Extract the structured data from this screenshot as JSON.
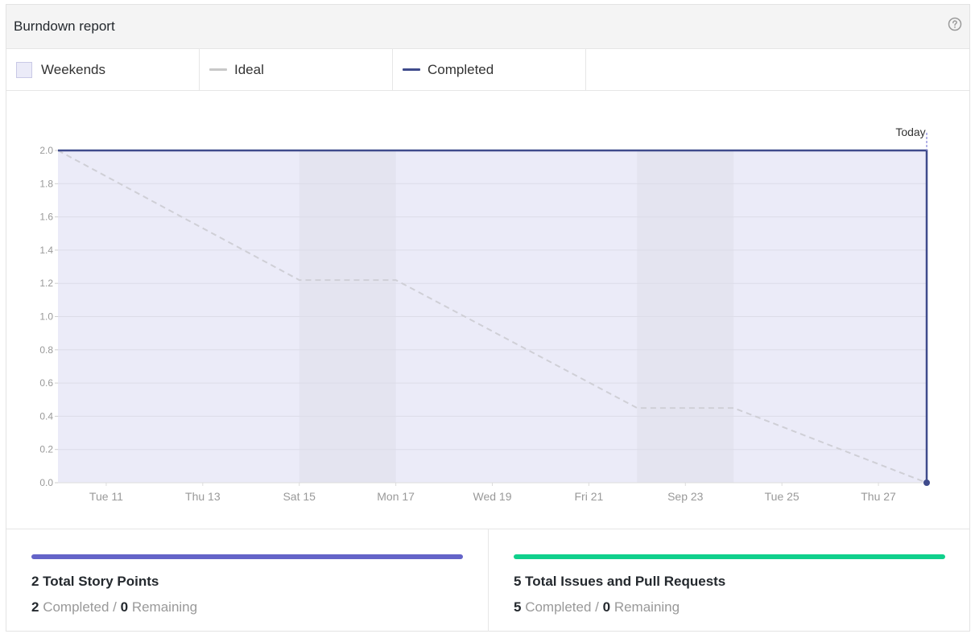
{
  "header": {
    "title": "Burndown report",
    "help_icon": "question-circle-icon"
  },
  "legend": {
    "items": [
      {
        "label": "Weekends",
        "kind": "swatch",
        "color": "#ebebf8"
      },
      {
        "label": "Ideal",
        "kind": "line",
        "color": "#c8c8c8"
      },
      {
        "label": "Completed",
        "kind": "line",
        "color": "#3f4b8c"
      }
    ]
  },
  "colors": {
    "plot_fill": "#ebebf8",
    "weekend_band": "#e4e4f0",
    "grid": "#dcdce8",
    "ideal": "#cfcfd6",
    "completed": "#3f4b8c",
    "today_marker": "#9a9ae0",
    "story_bar": "#6464c8",
    "issues_bar": "#10d08c"
  },
  "chart_data": {
    "type": "line",
    "x_start": "Sep 10",
    "x_end": "Sep 28",
    "x_tick_labels": [
      {
        "date": "Sep 11",
        "label": "Tue 11"
      },
      {
        "date": "Sep 13",
        "label": "Thu 13"
      },
      {
        "date": "Sep 15",
        "label": "Sat 15"
      },
      {
        "date": "Sep 17",
        "label": "Mon 17"
      },
      {
        "date": "Sep 19",
        "label": "Wed 19"
      },
      {
        "date": "Sep 21",
        "label": "Fri 21"
      },
      {
        "date": "Sep 23",
        "label": "Sep 23"
      },
      {
        "date": "Sep 25",
        "label": "Tue 25"
      },
      {
        "date": "Sep 27",
        "label": "Thu 27"
      }
    ],
    "y_ticks": [
      "0.0",
      "0.2",
      "0.4",
      "0.6",
      "0.8",
      "1.0",
      "1.2",
      "1.4",
      "1.6",
      "1.8",
      "2.0"
    ],
    "ylim": [
      0,
      2.0
    ],
    "grid": true,
    "weekends": [
      {
        "start": "Sep 15",
        "end": "Sep 17"
      },
      {
        "start": "Sep 22",
        "end": "Sep 24"
      }
    ],
    "series": [
      {
        "name": "Ideal",
        "style": "dashed",
        "points": [
          {
            "x": "Sep 10",
            "y": 2.0
          },
          {
            "x": "Sep 15",
            "y": 1.22
          },
          {
            "x": "Sep 17",
            "y": 1.22
          },
          {
            "x": "Sep 22",
            "y": 0.45
          },
          {
            "x": "Sep 24",
            "y": 0.45
          },
          {
            "x": "Sep 28",
            "y": 0.0
          }
        ]
      },
      {
        "name": "Completed",
        "style": "solid",
        "points": [
          {
            "x": "Sep 10",
            "y": 2.0
          },
          {
            "x": "Sep 28",
            "y": 2.0
          },
          {
            "x": "Sep 28",
            "y": 0.0
          }
        ]
      }
    ],
    "today_label": "Today",
    "today_x": "Sep 28"
  },
  "stats": {
    "story": {
      "title": "2 Total Story Points",
      "completed_value": "2",
      "completed_label": "Completed",
      "separator": "/",
      "remaining_value": "0",
      "remaining_label": "Remaining"
    },
    "issues": {
      "title": "5 Total Issues and Pull Requests",
      "completed_value": "5",
      "completed_label": "Completed",
      "separator": "/",
      "remaining_value": "0",
      "remaining_label": "Remaining"
    }
  }
}
